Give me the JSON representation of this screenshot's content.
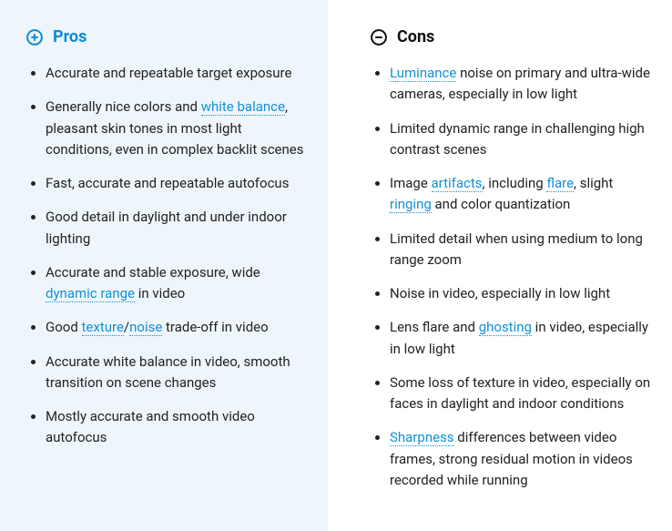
{
  "pros": {
    "title": "Pros",
    "items": [
      {
        "segments": [
          {
            "t": "Accurate and repeatable target exposure"
          }
        ]
      },
      {
        "segments": [
          {
            "t": "Generally nice colors and "
          },
          {
            "t": "white balance",
            "link": true
          },
          {
            "t": ", pleasant skin tones in most light conditions, even in complex backlit scenes"
          }
        ]
      },
      {
        "segments": [
          {
            "t": "Fast, accurate and repeatable autofocus"
          }
        ]
      },
      {
        "segments": [
          {
            "t": "Good detail in daylight and under indoor lighting"
          }
        ]
      },
      {
        "segments": [
          {
            "t": "Accurate and stable exposure, wide "
          },
          {
            "t": "dynamic range",
            "link": true
          },
          {
            "t": " in video"
          }
        ]
      },
      {
        "segments": [
          {
            "t": "Good "
          },
          {
            "t": "texture",
            "link": true
          },
          {
            "t": "/"
          },
          {
            "t": "noise",
            "link": true
          },
          {
            "t": " trade-off in video"
          }
        ]
      },
      {
        "segments": [
          {
            "t": "Accurate white balance in video, smooth transition on scene changes"
          }
        ]
      },
      {
        "segments": [
          {
            "t": "Mostly accurate and smooth video autofocus"
          }
        ]
      }
    ]
  },
  "cons": {
    "title": "Cons",
    "items": [
      {
        "segments": [
          {
            "t": "Luminance",
            "link": true
          },
          {
            "t": " noise on primary and ultra-wide cameras, especially in low light"
          }
        ]
      },
      {
        "segments": [
          {
            "t": "Limited dynamic range in challenging high contrast scenes"
          }
        ]
      },
      {
        "segments": [
          {
            "t": "Image "
          },
          {
            "t": "artifacts",
            "link": true
          },
          {
            "t": ", including "
          },
          {
            "t": "flare",
            "link": true
          },
          {
            "t": ", slight "
          },
          {
            "t": "ringing",
            "link": true
          },
          {
            "t": " and  color quantization"
          }
        ]
      },
      {
        "segments": [
          {
            "t": "Limited detail when using medium to long range zoom"
          }
        ]
      },
      {
        "segments": [
          {
            "t": "Noise in video, especially in low light"
          }
        ]
      },
      {
        "segments": [
          {
            "t": "Lens flare and "
          },
          {
            "t": "ghosting",
            "link": true
          },
          {
            "t": " in video, especially in low light"
          }
        ]
      },
      {
        "segments": [
          {
            "t": "Some loss of texture in video, especially on faces in daylight and indoor conditions"
          }
        ]
      },
      {
        "segments": [
          {
            "t": "Sharpness",
            "link": true
          },
          {
            "t": " differences between video frames, strong residual motion in videos recorded while running"
          }
        ]
      }
    ]
  }
}
